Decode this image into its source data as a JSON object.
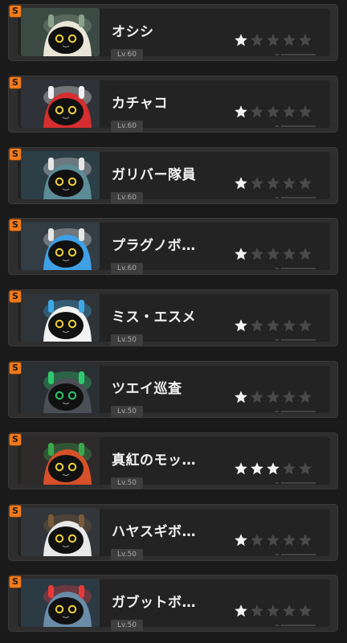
{
  "characters": [
    {
      "name": "オシシ",
      "rank": "S",
      "level": "Lv.60",
      "stars": 1,
      "max_stars": 5,
      "icon": "robot-lion-portrait",
      "palette": {
        "bg": "#3c4a44",
        "body": "#e9e6d8",
        "accent": "#8aa38a"
      }
    },
    {
      "name": "カチャコ",
      "rank": "S",
      "level": "Lv.60",
      "stars": 1,
      "max_stars": 5,
      "icon": "robot-red-cap-portrait",
      "palette": {
        "bg": "#2f3238",
        "body": "#d62e2e",
        "accent": "#f0f0f0"
      }
    },
    {
      "name": "ガリバー隊員",
      "rank": "S",
      "level": "Lv.60",
      "stars": 1,
      "max_stars": 5,
      "icon": "robot-bunny-soldier-portrait",
      "palette": {
        "bg": "#2c3e46",
        "body": "#5c8c96",
        "accent": "#e6e6e6"
      }
    },
    {
      "name": "プラグノボ…",
      "rank": "S",
      "level": "Lv.60",
      "stars": 1,
      "max_stars": 5,
      "icon": "robot-blue-plug-portrait",
      "palette": {
        "bg": "#333d44",
        "body": "#3fa0e6",
        "accent": "#e6e6e6"
      }
    },
    {
      "name": "ミス・エスメ",
      "rank": "S",
      "level": "Lv.50",
      "stars": 1,
      "max_stars": 5,
      "icon": "robot-panda-portrait",
      "palette": {
        "bg": "#2f3438",
        "body": "#f2f2f2",
        "accent": "#3fa6e6"
      }
    },
    {
      "name": "ツエイ巡査",
      "rank": "S",
      "level": "Lv.50",
      "stars": 1,
      "max_stars": 5,
      "icon": "robot-rabbit-officer-portrait",
      "palette": {
        "bg": "#2a2f33",
        "body": "#4a4f55",
        "accent": "#2ec96b"
      }
    },
    {
      "name": "真紅のモッ…",
      "rank": "S",
      "level": "Lv.50",
      "stars": 3,
      "max_stars": 5,
      "icon": "robot-red-pig-portrait",
      "palette": {
        "bg": "#2e2a2a",
        "body": "#d6502a",
        "accent": "#3aa84a"
      }
    },
    {
      "name": "ハヤスギボ…",
      "rank": "S",
      "level": "Lv.50",
      "stars": 1,
      "max_stars": 5,
      "icon": "robot-aviator-portrait",
      "palette": {
        "bg": "#32363a",
        "body": "#e8e8e8",
        "accent": "#7a5a3a"
      }
    },
    {
      "name": "ガブットボ…",
      "rank": "S",
      "level": "Lv.50",
      "stars": 1,
      "max_stars": 5,
      "icon": "robot-shark-portrait",
      "palette": {
        "bg": "#2c3a44",
        "body": "#6a8ca8",
        "accent": "#e63a3a"
      }
    }
  ],
  "colors": {
    "star_active": "#f2f2f2",
    "star_inactive": "#4a4a4a",
    "rank_badge": "#f07a1a",
    "eyes_default": "#f0d23a",
    "eyes_officer": "#2ec96b"
  }
}
